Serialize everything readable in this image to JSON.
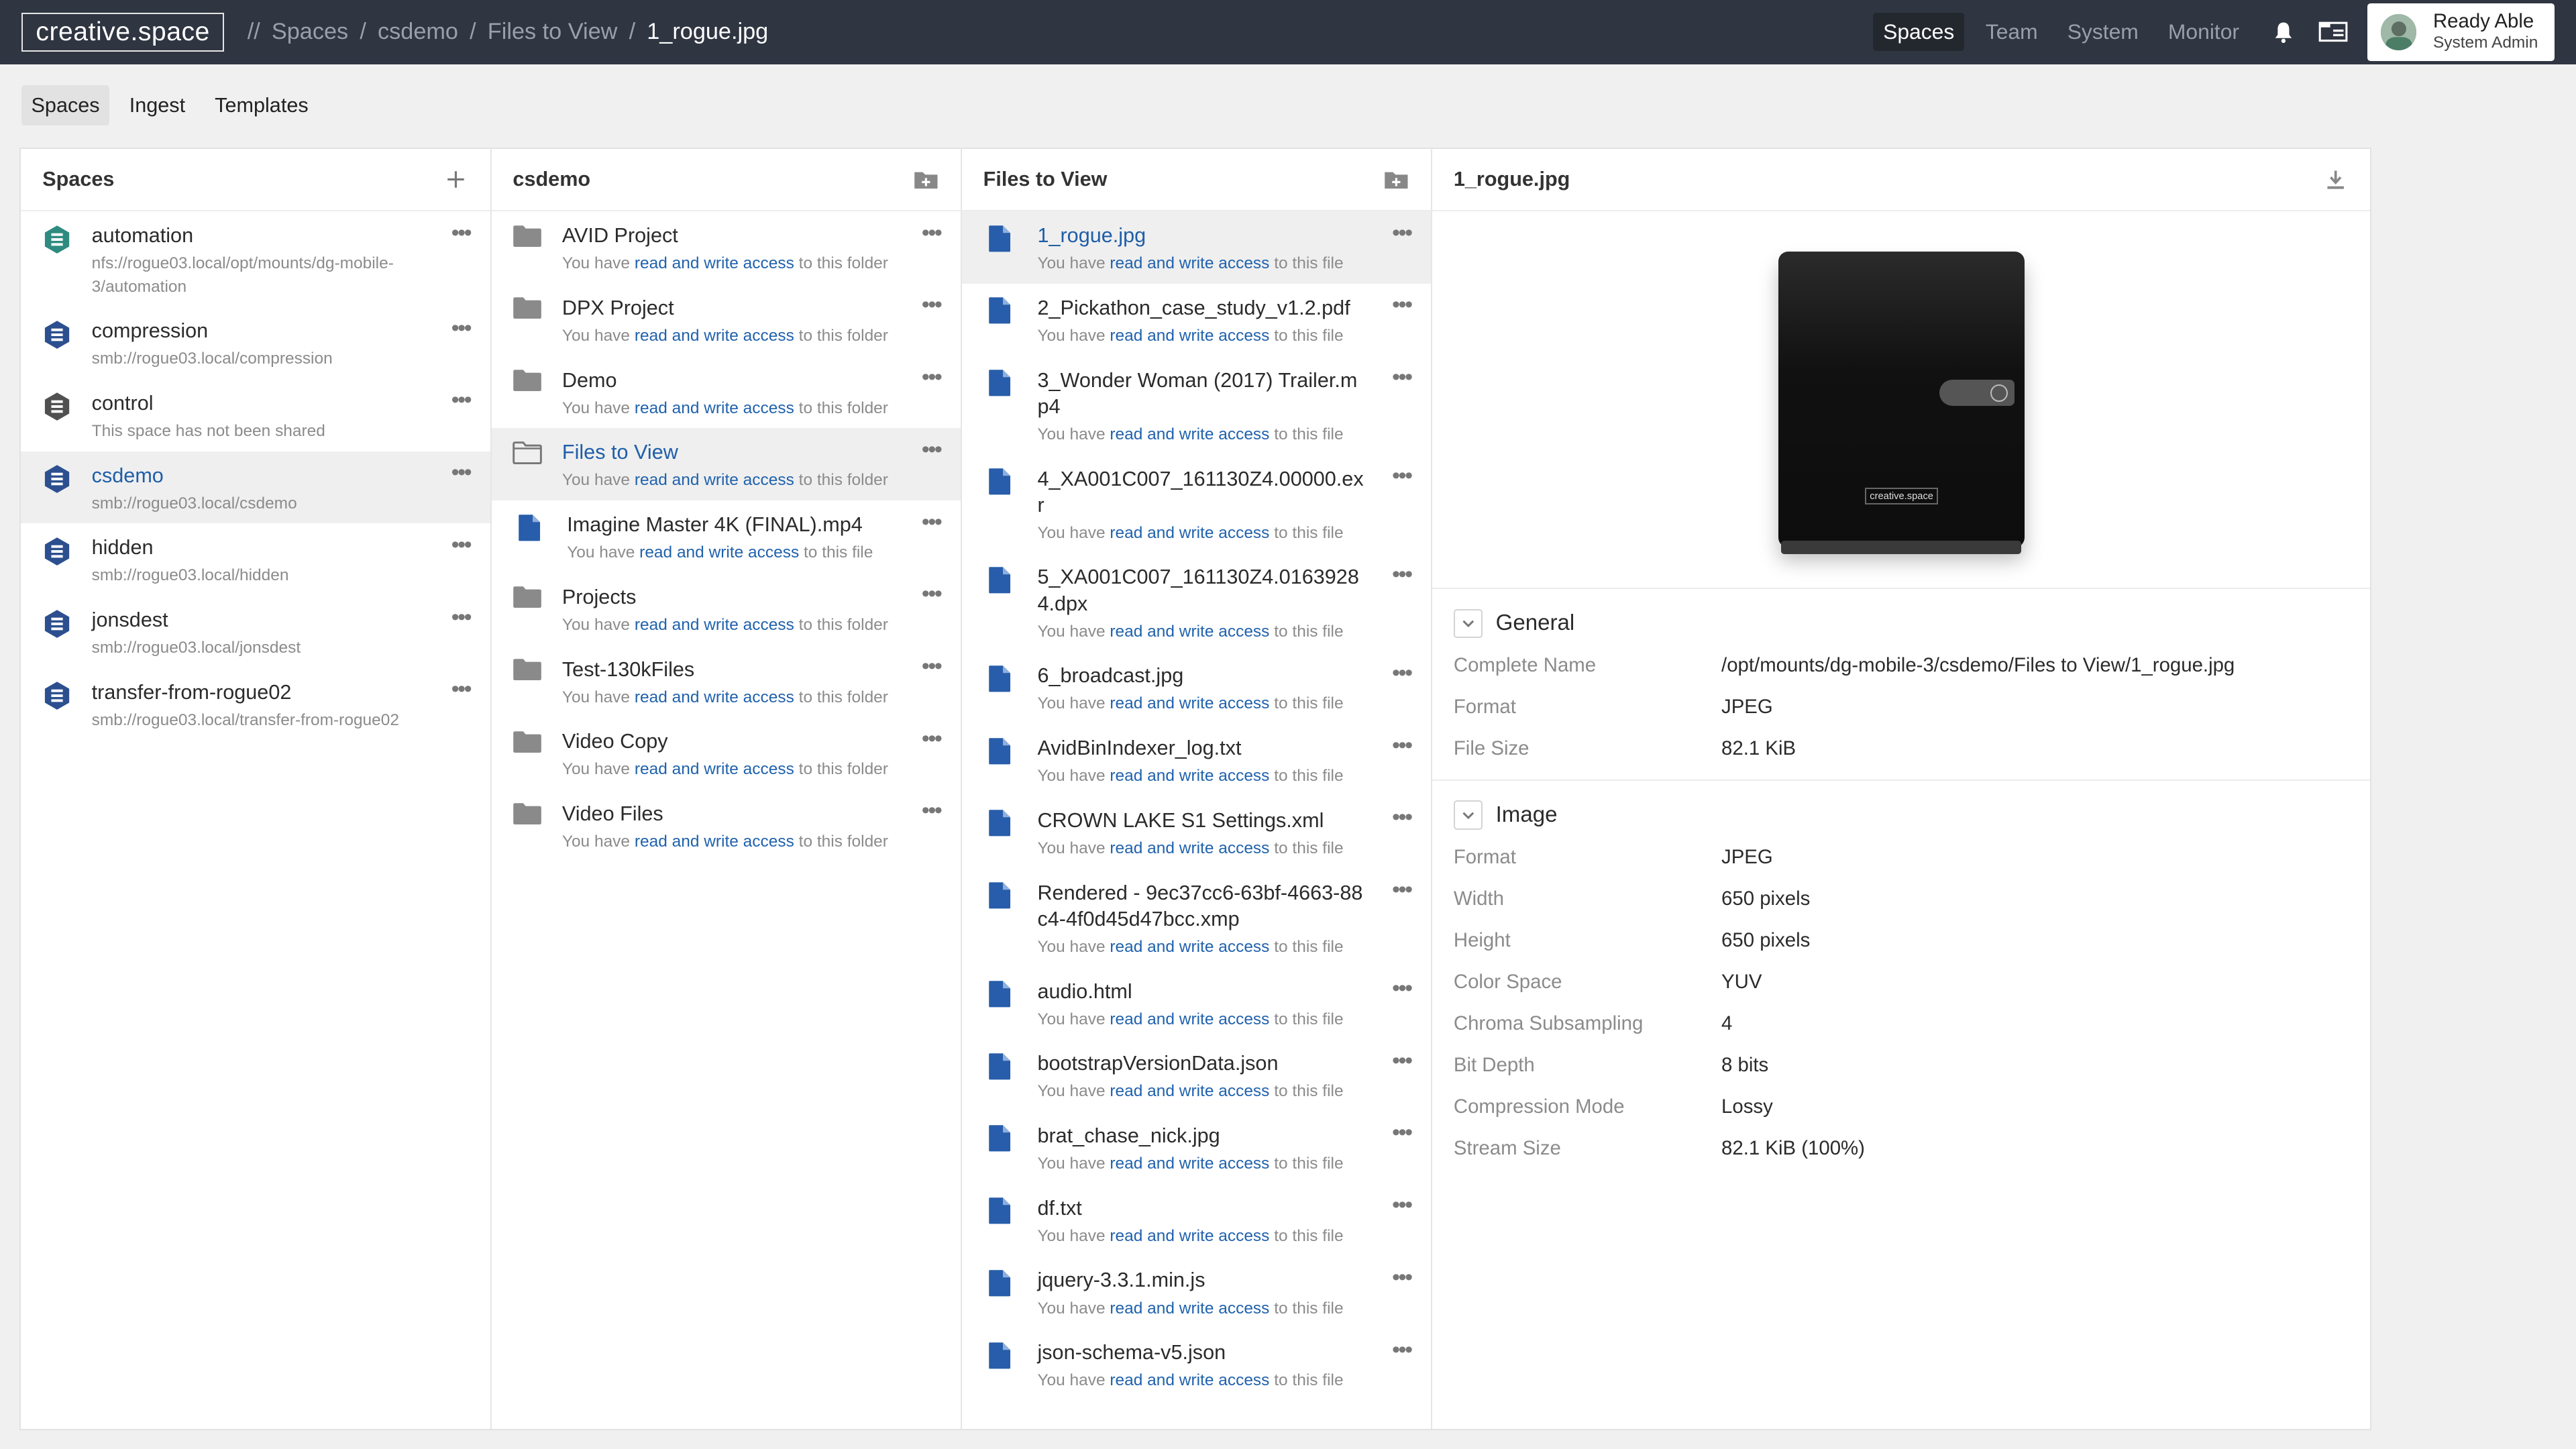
{
  "app": {
    "logo": "creative.space",
    "breadcrumb": [
      {
        "label": "//"
      },
      {
        "label": "Spaces"
      },
      {
        "label": "csdemo"
      },
      {
        "label": "Files to View"
      },
      {
        "label": "1_rogue.jpg"
      }
    ],
    "nav": [
      "Spaces",
      "Team",
      "System",
      "Monitor"
    ],
    "user": {
      "name": "Ready Able",
      "role": "System Admin"
    }
  },
  "subtabs": [
    "Spaces",
    "Ingest",
    "Templates"
  ],
  "spaces": {
    "title": "Spaces",
    "items": [
      {
        "name": "automation",
        "path": "nfs://rogue03.local/opt/mounts/dg-mobile-3/automation",
        "color": "#2e8b80"
      },
      {
        "name": "compression",
        "path": "smb://rogue03.local/compression",
        "color": "#2c4f8f"
      },
      {
        "name": "control",
        "path": "This space has not been shared",
        "color": "#505050"
      },
      {
        "name": "csdemo",
        "path": "smb://rogue03.local/csdemo",
        "color": "#2c4f8f"
      },
      {
        "name": "hidden",
        "path": "smb://rogue03.local/hidden",
        "color": "#2c4f8f"
      },
      {
        "name": "jonsdest",
        "path": "smb://rogue03.local/jonsdest",
        "color": "#2c4f8f"
      },
      {
        "name": "transfer-from-rogue02",
        "path": "smb://rogue03.local/transfer-from-rogue02",
        "color": "#2c4f8f"
      }
    ]
  },
  "access": {
    "pre": "You have ",
    "link": "read and write access",
    "folder_post": " to this folder",
    "file_post": " to this file"
  },
  "csdemo": {
    "title": "csdemo",
    "items": [
      {
        "name": "AVID Project",
        "kind": "folder"
      },
      {
        "name": "DPX Project",
        "kind": "folder"
      },
      {
        "name": "Demo",
        "kind": "folder"
      },
      {
        "name": "Files to View",
        "kind": "folder-open"
      },
      {
        "name": "Imagine Master 4K (FINAL).mp4",
        "kind": "file"
      },
      {
        "name": "Projects",
        "kind": "folder"
      },
      {
        "name": "Test-130kFiles",
        "kind": "folder"
      },
      {
        "name": "Video Copy",
        "kind": "folder"
      },
      {
        "name": "Video Files",
        "kind": "folder"
      }
    ]
  },
  "files": {
    "title": "Files to View",
    "items": [
      "1_rogue.jpg",
      "2_Pickathon_case_study_v1.2.pdf",
      "3_Wonder Woman (2017) Trailer.mp4",
      "4_XA001C007_161130Z4.00000.exr",
      "5_XA001C007_161130Z4.01639284.dpx",
      "6_broadcast.jpg",
      "AvidBinIndexer_log.txt",
      "CROWN LAKE S1 Settings.xml",
      "Rendered - 9ec37cc6-63bf-4663-88c4-4f0d45d47bcc.xmp",
      "audio.html",
      "bootstrapVersionData.json",
      "brat_chase_nick.jpg",
      "df.txt",
      "jquery-3.3.1.min.js",
      "json-schema-v5.json"
    ]
  },
  "detail": {
    "title": "1_rogue.jpg",
    "preview_brand": "creative.space",
    "general": {
      "title": "General",
      "rows": [
        {
          "k": "Complete Name",
          "v": "/opt/mounts/dg-mobile-3/csdemo/Files to View/1_rogue.jpg"
        },
        {
          "k": "Format",
          "v": "JPEG"
        },
        {
          "k": "File Size",
          "v": "82.1 KiB"
        }
      ]
    },
    "image": {
      "title": "Image",
      "rows": [
        {
          "k": "Format",
          "v": "JPEG"
        },
        {
          "k": "Width",
          "v": "650 pixels"
        },
        {
          "k": "Height",
          "v": "650 pixels"
        },
        {
          "k": "Color Space",
          "v": "YUV"
        },
        {
          "k": "Chroma Subsampling",
          "v": "4"
        },
        {
          "k": "Bit Depth",
          "v": "8 bits"
        },
        {
          "k": "Compression Mode",
          "v": "Lossy"
        },
        {
          "k": "Stream Size",
          "v": "82.1 KiB (100%)"
        }
      ]
    }
  }
}
